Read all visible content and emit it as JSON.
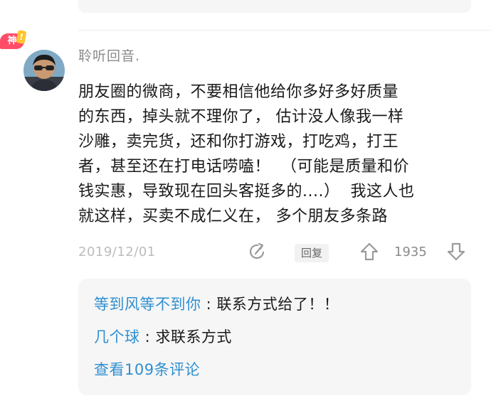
{
  "badge": {
    "label": "神",
    "mark": "!"
  },
  "comment": {
    "username": "聆听回音.",
    "text": "朋友圈的微商，不要相信他给你多好多好质量\n的东西，掉头就不理你了， 估计没人像我一样\n沙雕，卖完货，还和你打游戏，打吃鸡，打王\n者，甚至还在打电话唠嗑！  （可能是质量和价\n钱实惠，导致现在回头客挺多的....）  我这人也\n就这样，买卖不成仁义在， 多个朋友多条路",
    "date": "2019/12/01",
    "reply_label": "回复",
    "vote_count": "1935"
  },
  "replies": [
    {
      "name": "等到风等不到你",
      "sep": " : ",
      "text": "联系方式给了！！"
    },
    {
      "name": "几个球",
      "sep": " : ",
      "text": "求联系方式"
    }
  ],
  "more_link": "查看109条评论",
  "icons": {
    "avatar": "avatar-photo",
    "share": "share-icon",
    "upvote": "upvote-icon",
    "downvote": "downvote-icon"
  },
  "colors": {
    "link": "#2f8fd1",
    "badge": "#ff4d67",
    "muted": "#8a8a8a"
  }
}
